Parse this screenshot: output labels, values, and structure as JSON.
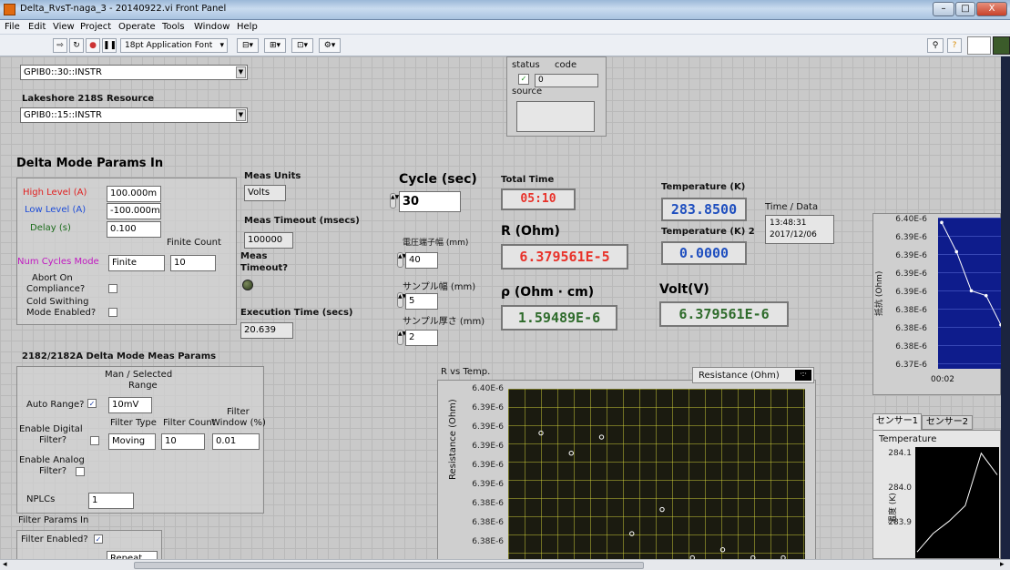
{
  "window": {
    "title": "Delta_RvsT-naga_3 - 20140922.vi Front Panel",
    "controls": [
      "–",
      "□",
      "X"
    ]
  },
  "menu": [
    "File",
    "Edit",
    "View",
    "Project",
    "Operate",
    "Tools",
    "Window",
    "Help"
  ],
  "toolbar": {
    "font": "18pt Application Font"
  },
  "resources": {
    "gpib_top": "GPIB0::30::INSTR",
    "lakeshore_label": "Lakeshore 218S Resource",
    "lakeshore_value": "GPIB0::15::INSTR"
  },
  "error_cluster": {
    "status_label": "status",
    "code_label": "code",
    "code_value": "0",
    "source_label": "source"
  },
  "delta_params": {
    "title": "Delta Mode Params In",
    "high_label": "High Level (A)",
    "high_value": "100.000m",
    "low_label": "Low Level (A)",
    "low_value": "-100.000m",
    "delay_label": "Delay (s)",
    "delay_value": "0.100",
    "finite_count_label": "Finite Count",
    "num_cycles_label": "Num Cycles Mode",
    "num_cycles_value": "Finite",
    "finite_count_value": "10",
    "abort_label_1": "Abort On",
    "abort_label_2": "Compliance?",
    "cold_label_1": "Cold Swithing",
    "cold_label_2": "Mode Enabled?"
  },
  "meas": {
    "units_label": "Meas Units",
    "units_value": "Volts",
    "timeout_label": "Meas Timeout (msecs)",
    "timeout_value": "100000",
    "timeout_q_1": "Meas",
    "timeout_q_2": "Timeout?",
    "exec_label": "Execution Time (secs)",
    "exec_value": "20.639"
  },
  "cycle": {
    "label": "Cycle (sec)",
    "value": "30",
    "v_term_label": "電圧端子幅 (mm)",
    "v_term_value": "40",
    "width_label": "サンプル幅 (mm)",
    "width_value": "5",
    "thick_label": "サンプル厚さ (mm)",
    "thick_value": "2"
  },
  "results": {
    "total_time_label": "Total Time",
    "total_time_value": "05:10",
    "r_label": "R (Ohm)",
    "r_value": "6.379561E-5",
    "rho_label": "ρ (Ohm · cm)",
    "rho_value": "1.59489E-6",
    "temp_label": "Temperature (K)",
    "temp_value": "283.8500",
    "temp2_label": "Temperature (K) 2",
    "temp2_value": "0.0000",
    "volt_label": "Volt(V)",
    "volt_value": "6.379561E-6",
    "time_data_label": "Time / Data",
    "time_value": "13:48:31",
    "date_value": "2017/12/06",
    "r_color": "#e8322a",
    "rho_color": "#2e6b2b",
    "temp_color": "#1f4fbf"
  },
  "delta2182": {
    "title": "2182/2182A Delta Mode Meas Params",
    "man_label_1": "Man / Selected",
    "man_label_2": "Range",
    "auto_label": "Auto Range?",
    "range_value": "10mV",
    "filter_label": "Filter",
    "filter_type_label": "Filter Type",
    "filter_count_label": "Filter Count",
    "filter_window_label": "Window (%)",
    "digital_label_1": "Enable Digital",
    "digital_label_2": "Filter?",
    "filter_type_value": "Moving",
    "filter_count_value": "10",
    "filter_window_value": "0.01",
    "analog_label_1": "Enable Analog",
    "analog_label_2": "Filter?",
    "nplc_label": "NPLCs",
    "nplc_value": "1",
    "filter_params_label": "Filter Params In",
    "filter_enabled_label": "Filter Enabled?",
    "filter_type2_value": "Repeat"
  },
  "chart_data": [
    {
      "type": "scatter",
      "title": "R vs Temp.",
      "legend": "Resistance (Ohm)",
      "ylabel": "Resistance (Ohm)",
      "yticks": [
        "6.40E-6",
        "6.39E-6",
        "6.39E-6",
        "6.39E-6",
        "6.39E-6",
        "6.39E-6",
        "6.38E-6",
        "6.38E-6",
        "6.38E-6"
      ],
      "points_y": [
        6.3955e-06,
        6.393e-06,
        6.395e-06,
        6.383e-06,
        6.386e-06,
        6.38e-06,
        6.381e-06,
        6.38e-06,
        6.38e-06
      ],
      "ylim": [
        6.3795e-06,
        6.401e-06
      ]
    },
    {
      "type": "line",
      "ylabel": "抵抗 (Ohm)",
      "yticks": [
        "6.40E-6",
        "6.39E-6",
        "6.39E-6",
        "6.39E-6",
        "6.39E-6",
        "6.38E-6",
        "6.38E-6",
        "6.38E-6",
        "6.37E-6"
      ],
      "xticks": [
        "00:02"
      ],
      "values": [
        6.4e-06,
        6.394e-06,
        6.386e-06,
        6.385e-06,
        6.379e-06
      ],
      "ylim": [
        6.37e-06,
        6.401e-06
      ]
    },
    {
      "type": "line",
      "tabs": [
        "センサー1",
        "センサー2"
      ],
      "title": "Temperature",
      "ylabel": "温度 (K)",
      "yticks": [
        "284.1",
        "284.0",
        "283.9"
      ],
      "values": [
        283.8,
        283.86,
        283.9,
        283.95,
        284.12,
        284.05
      ],
      "ylim": [
        283.78,
        284.14
      ]
    }
  ]
}
